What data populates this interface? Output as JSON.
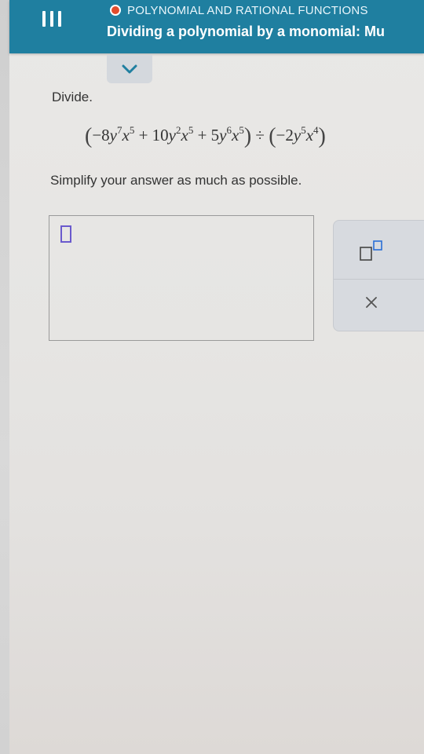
{
  "header": {
    "topic": "POLYNOMIAL AND RATIONAL FUNCTIONS",
    "title": "Dividing a polynomial by a monomial: Mu",
    "status_color": "#e24c2c",
    "bar_color": "#1f7fa0"
  },
  "icons": {
    "menu": "menu-icon",
    "collapse": "chevron-down-icon",
    "exponent": "exponent-template-icon",
    "clear": "clear-x-icon"
  },
  "question": {
    "label": "Divide.",
    "expression": {
      "t1_coef": "−8",
      "t1_v1": "y",
      "t1_e1": "7",
      "t1_v2": "x",
      "t1_e2": "5",
      "t2_coef": "+ 10",
      "t2_v1": "y",
      "t2_e1": "2",
      "t2_v2": "x",
      "t2_e2": "5",
      "t3_coef": "+ 5",
      "t3_v1": "y",
      "t3_e1": "6",
      "t3_v2": "x",
      "t3_e2": "5",
      "divide_sign": " ÷ ",
      "d_coef": "−2",
      "d_v1": "y",
      "d_e1": "5",
      "d_v2": "x",
      "d_e2": "4"
    },
    "instruction": "Simplify your answer as much as possible."
  },
  "answer": {
    "value": ""
  }
}
